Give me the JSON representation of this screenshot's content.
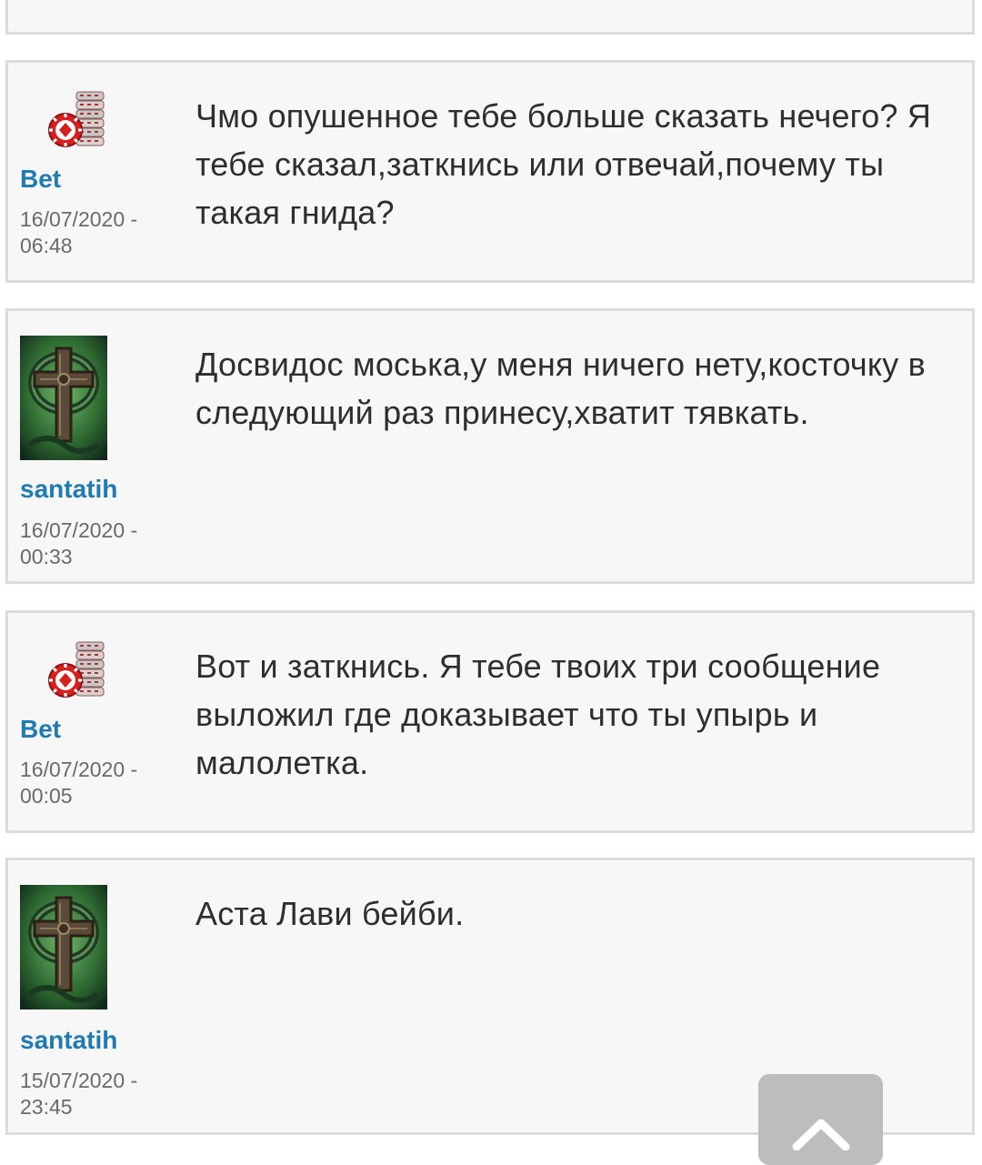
{
  "posts": [
    {
      "author": "Bet",
      "avatar_icon": "poker-chips-icon",
      "date_line1": "16/07/2020 -",
      "date_line2": "06:48",
      "message": "Чмо опушенное тебе больше сказать нечего? Я тебе сказал,заткнись или отвечай,почему ты такая гнида?"
    },
    {
      "author": "santatih",
      "avatar_icon": "celtic-cross-icon",
      "date_line1": "16/07/2020 -",
      "date_line2": "00:33",
      "message": "Досвидос моська,у меня ничего нету,косточку в следующий раз принесу,хватит тявкать."
    },
    {
      "author": "Bet",
      "avatar_icon": "poker-chips-icon",
      "date_line1": "16/07/2020 -",
      "date_line2": "00:05",
      "message": "Вот и заткнись. Я тебе твоих три сообщение выложил где доказывает что ты упырь и малолетка."
    },
    {
      "author": "santatih",
      "avatar_icon": "celtic-cross-icon",
      "date_line1": "15/07/2020 -",
      "date_line2": "23:45",
      "message": "Аста Лави бейби."
    }
  ],
  "scroll_top_icon": "chevron-up-icon",
  "colors": {
    "username": "#1f7bb0",
    "date": "#6a6a6a",
    "message": "#2e2e2e",
    "card_bg": "#f7f7f7",
    "card_border": "#dcdcdc",
    "scroll_button": "#bdbdbd"
  }
}
